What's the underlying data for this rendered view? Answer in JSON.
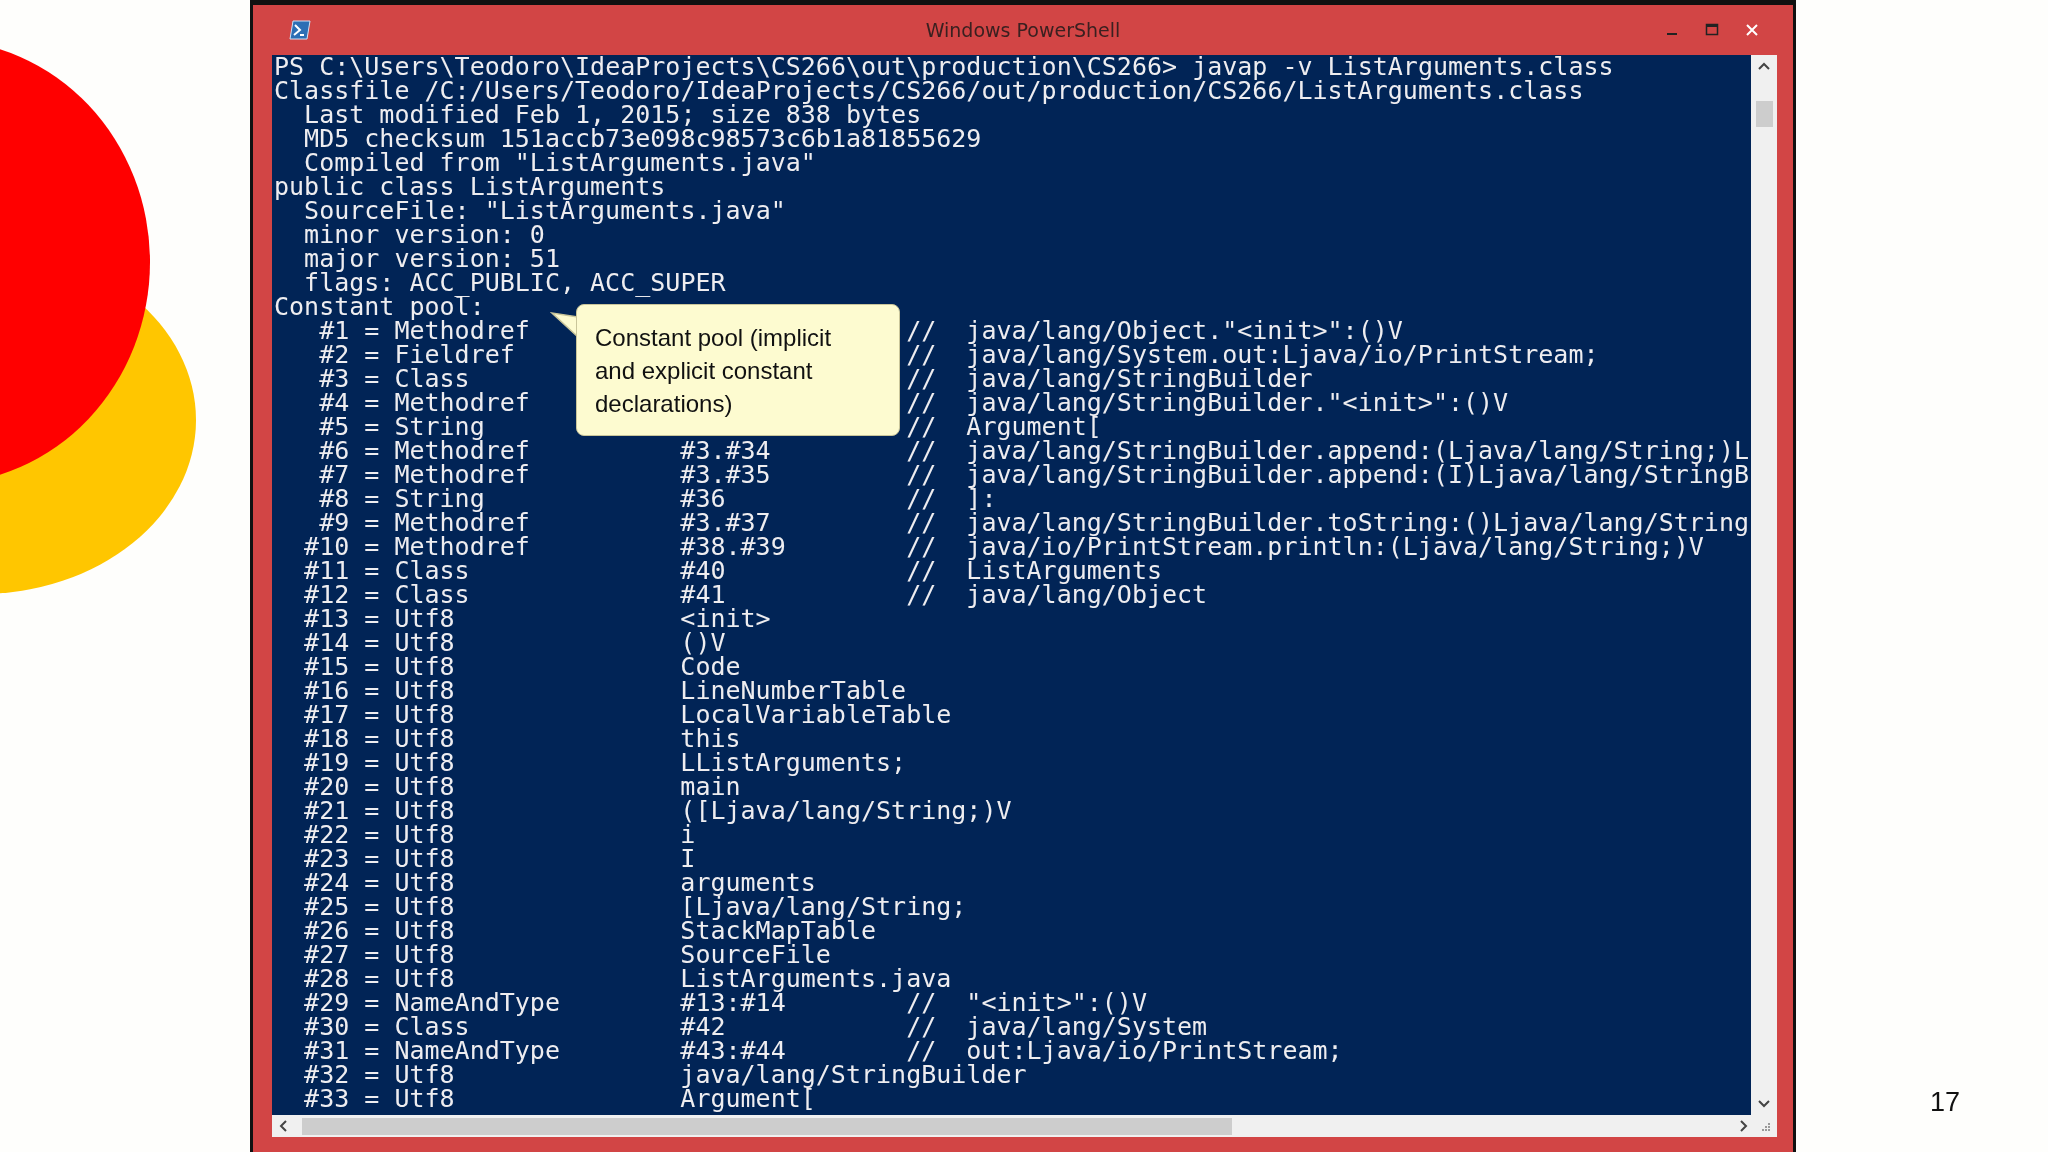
{
  "window": {
    "title": "Windows PowerShell"
  },
  "console": {
    "prompt": "PS C:\\Users\\Teodoro\\IdeaProjects\\CS266\\out\\production\\CS266> javap -v ListArguments.class",
    "sections": [
      {
        "heading": "Classfile /C:/Users/Teodoro/IdeaProjects/CS266/out/production/CS266/ListArguments.class",
        "children": [
          "Last modified Feb 1, 2015; size 838 bytes",
          "MD5 checksum 151accb73e098c98573c6b1a81855629",
          "Compiled from \"ListArguments.java\""
        ]
      },
      {
        "heading": "public class ListArguments",
        "children": [
          "SourceFile: \"ListArguments.java\"",
          "minor version: 0",
          "major version: 51",
          "flags: ACC_PUBLIC, ACC_SUPER"
        ]
      }
    ],
    "constant_pool": {
      "heading": "Constant pool:",
      "entries": [
        {
          "index": "#1",
          "type": "= Methodref",
          "comment": "//  java/lang/Object.\"<init>\":()V"
        },
        {
          "index": "#2",
          "type": "= Fieldref",
          "comment": "//  java/lang/System.out:Ljava/io/PrintStream;"
        },
        {
          "index": "#3",
          "type": "= Class",
          "comment": "//  java/lang/StringBuilder"
        },
        {
          "index": "#4",
          "type": "= Methodref",
          "comment": "//  java/lang/StringBuilder.\"<init>\":()V"
        },
        {
          "index": "#5",
          "type": "= String",
          "comment": "//  Argument["
        },
        {
          "index": "#6",
          "type": "= Methodref",
          "ref": "#3.#34",
          "comment": "//  java/lang/StringBuilder.append:(Ljava/lang/String;)L"
        },
        {
          "index": "#7",
          "type": "= Methodref",
          "ref": "#3.#35",
          "comment": "//  java/lang/StringBuilder.append:(I)Ljava/lang/StringB"
        },
        {
          "index": "#8",
          "type": "= String",
          "ref": "#36",
          "comment": "//  ]:"
        },
        {
          "index": "#9",
          "type": "= Methodref",
          "ref": "#3.#37",
          "comment": "//  java/lang/StringBuilder.toString:()Ljava/lang/String"
        },
        {
          "index": "#10",
          "type": "= Methodref",
          "ref": "#38.#39",
          "comment": "//  java/io/PrintStream.println:(Ljava/lang/String;)V"
        },
        {
          "index": "#11",
          "type": "= Class",
          "ref": "#40",
          "comment": "//  ListArguments"
        },
        {
          "index": "#12",
          "type": "= Class",
          "ref": "#41",
          "comment": "//  java/lang/Object"
        },
        {
          "index": "#13",
          "type": "= Utf8",
          "ref": "<init>"
        },
        {
          "index": "#14",
          "type": "= Utf8",
          "ref": "()V"
        },
        {
          "index": "#15",
          "type": "= Utf8",
          "ref": "Code"
        },
        {
          "index": "#16",
          "type": "= Utf8",
          "ref": "LineNumberTable"
        },
        {
          "index": "#17",
          "type": "= Utf8",
          "ref": "LocalVariableTable"
        },
        {
          "index": "#18",
          "type": "= Utf8",
          "ref": "this"
        },
        {
          "index": "#19",
          "type": "= Utf8",
          "ref": "LListArguments;"
        },
        {
          "index": "#20",
          "type": "= Utf8",
          "ref": "main"
        },
        {
          "index": "#21",
          "type": "= Utf8",
          "ref": "([Ljava/lang/String;)V"
        },
        {
          "index": "#22",
          "type": "= Utf8",
          "ref": "i"
        },
        {
          "index": "#23",
          "type": "= Utf8",
          "ref": "I"
        },
        {
          "index": "#24",
          "type": "= Utf8",
          "ref": "arguments"
        },
        {
          "index": "#25",
          "type": "= Utf8",
          "ref": "[Ljava/lang/String;"
        },
        {
          "index": "#26",
          "type": "= Utf8",
          "ref": "StackMapTable"
        },
        {
          "index": "#27",
          "type": "= Utf8",
          "ref": "SourceFile"
        },
        {
          "index": "#28",
          "type": "= Utf8",
          "ref": "ListArguments.java"
        },
        {
          "index": "#29",
          "type": "= NameAndType",
          "ref": "#13:#14",
          "comment": "//  \"<init>\":()V"
        },
        {
          "index": "#30",
          "type": "= Class",
          "ref": "#42",
          "comment": "//  java/lang/System"
        },
        {
          "index": "#31",
          "type": "= NameAndType",
          "ref": "#43:#44",
          "comment": "//  out:Ljava/io/PrintStream;"
        },
        {
          "index": "#32",
          "type": "= Utf8",
          "ref": "java/lang/StringBuilder"
        },
        {
          "index": "#33",
          "type": "= Utf8",
          "ref": "Argument["
        }
      ]
    }
  },
  "callout": {
    "text": "Constant pool (implicit and explicit constant declarations)"
  },
  "slide": {
    "page_number": "17"
  }
}
